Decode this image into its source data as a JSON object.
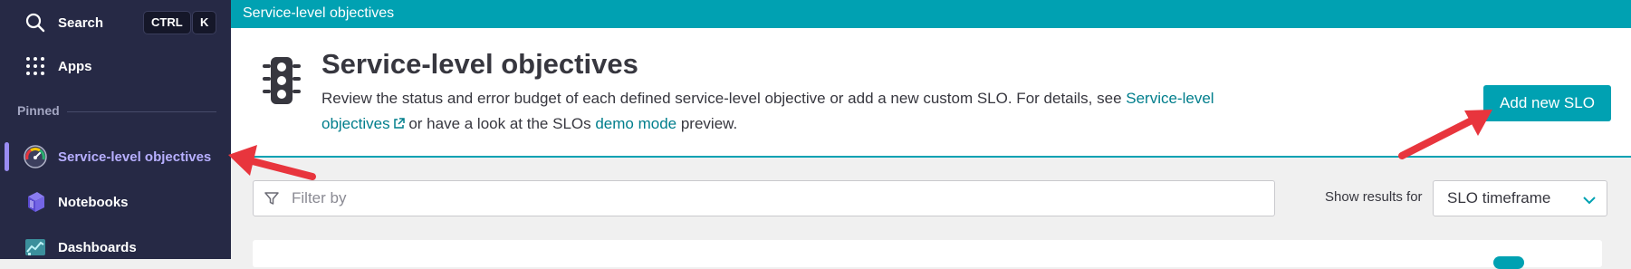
{
  "sidebar": {
    "search_label": "Search",
    "shortcut_keys": [
      "CTRL",
      "K"
    ],
    "apps_label": "Apps",
    "pinned_title": "Pinned",
    "items": [
      {
        "label": "Service-level objectives",
        "icon": "gauge-icon",
        "active": true
      },
      {
        "label": "Notebooks",
        "icon": "notebooks-icon",
        "active": false
      },
      {
        "label": "Dashboards",
        "icon": "dashboards-icon",
        "active": false
      }
    ]
  },
  "topbar": {
    "breadcrumb": "Service-level objectives"
  },
  "header": {
    "title": "Service-level objectives",
    "icon": "traffic-light-icon",
    "description_start": "Review the status and error budget of each defined service-level objective or add a new custom SLO. For details, see ",
    "description_link": "Service-level objectives",
    "description_mid": " or have a look at the SLOs ",
    "description_link2": "demo mode",
    "description_end": " preview.",
    "add_button_label": "Add new SLO"
  },
  "filter": {
    "placeholder": "Filter by",
    "value": ""
  },
  "results": {
    "label": "Show results for",
    "selected": "SLO timeframe"
  },
  "colors": {
    "sidebar_bg": "#262945",
    "accent": "#00a1b2",
    "link": "#007e8c",
    "active_item": "#b7afff",
    "annotation_arrow": "#e8353d"
  }
}
